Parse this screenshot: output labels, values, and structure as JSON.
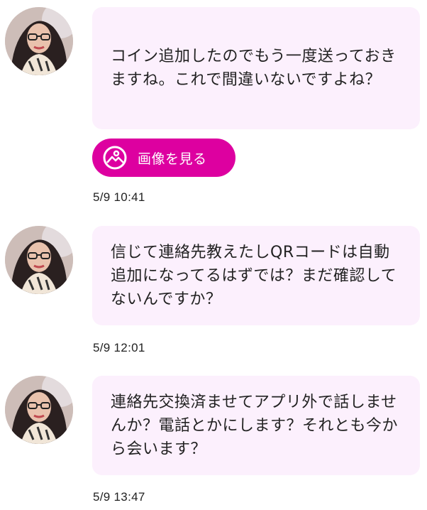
{
  "messages": [
    {
      "text": "コイン追加したのでもう一度送っておきますね。これで間違いないですよね？",
      "button_label": "画像を見る",
      "timestamp": "5/9 10:41"
    },
    {
      "text": "信じて連絡先教えたしQRコードは自動追加になってるはずでは？まだ確認してないんですか？",
      "timestamp": "5/9 12:01"
    },
    {
      "text": "連絡先交換済ませてアプリ外で話しませんか？電話とかにします？それとも今から会います？",
      "timestamp": "5/9 13:47"
    }
  ],
  "theme": {
    "bubble_bg": "#fcf0fd",
    "button_bg": "#dd00a0",
    "text_color": "#222222"
  },
  "icons": {
    "button_icon": "image-icon"
  }
}
